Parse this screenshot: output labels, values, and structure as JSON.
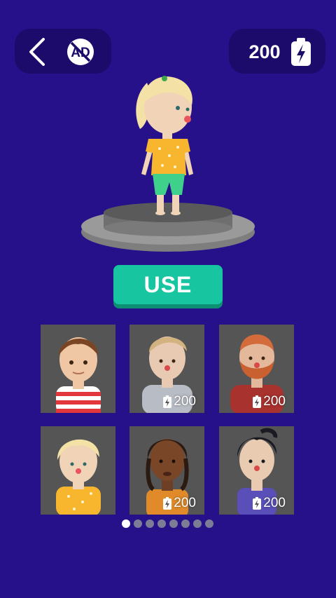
{
  "header": {
    "back_icon": "chevron-left-icon",
    "no_ads_icon": "no-ads-icon",
    "no_ads_label": "AD",
    "energy_count": "200",
    "energy_icon": "battery-bolt-icon"
  },
  "preview": {
    "use_label": "USE"
  },
  "skins": [
    {
      "id": "boy-striped",
      "price": null,
      "locked": false
    },
    {
      "id": "blond-grey-shirt",
      "price": "200",
      "locked": true
    },
    {
      "id": "ginger-beard",
      "price": "200",
      "locked": true
    },
    {
      "id": "blonde-girl-dots",
      "price": null,
      "locked": false
    },
    {
      "id": "braids-orange",
      "price": "200",
      "locked": true
    },
    {
      "id": "dark-hair-purple",
      "price": "200",
      "locked": true
    }
  ],
  "pager": {
    "total": 8,
    "current": 1
  },
  "colors": {
    "background": "#26118a",
    "panel": "#1d0b6b",
    "use_button": "#17c5a0",
    "card": "#555555"
  }
}
